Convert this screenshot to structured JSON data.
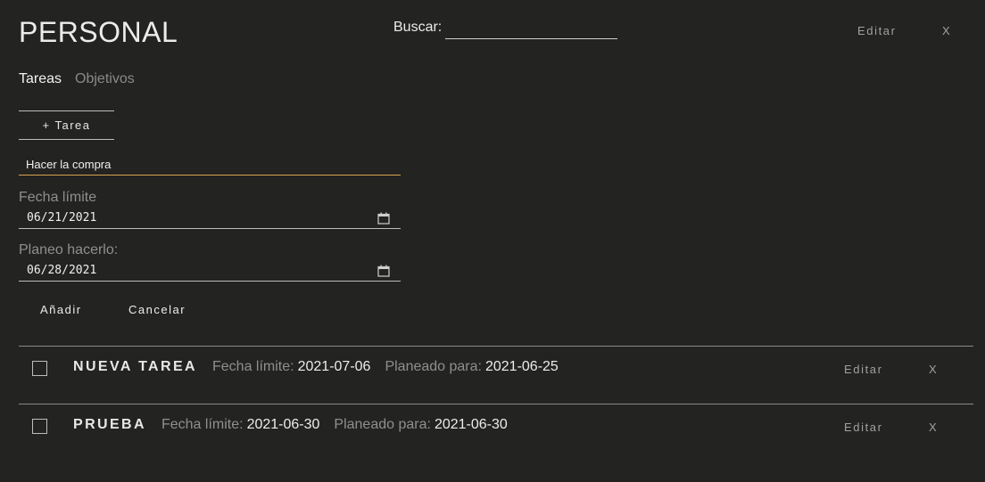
{
  "header": {
    "title": "PERSONAL",
    "search_label": "Buscar:",
    "search_value": "",
    "edit_label": "Editar",
    "close_label": "X"
  },
  "tabs": [
    {
      "label": "Tareas",
      "active": true
    },
    {
      "label": "Objetivos",
      "active": false
    }
  ],
  "form": {
    "add_task_label": "+ Tarea",
    "task_name_value": "Hacer la compra",
    "due_label": "Fecha límite",
    "due_value": "06/21/2021",
    "plan_label": "Planeo hacerlo:",
    "plan_value": "06/28/2021",
    "add_button": "Añadir",
    "cancel_button": "Cancelar"
  },
  "tasks": [
    {
      "name": "NUEVA TAREA",
      "due_label": "Fecha límite:",
      "due": "2021-07-06",
      "planned_label": "Planeado para:",
      "planned": "2021-06-25",
      "edit_label": "Editar",
      "close_label": "X",
      "checked": false
    },
    {
      "name": "PRUEBA",
      "due_label": "Fecha límite:",
      "due": "2021-06-30",
      "planned_label": "Planeado para:",
      "planned": "2021-06-30",
      "edit_label": "Editar",
      "close_label": "X",
      "checked": false
    }
  ],
  "colors": {
    "background": "#232321",
    "active_input_underline": "#d9a24a",
    "muted_text": "#8f8f8f"
  }
}
